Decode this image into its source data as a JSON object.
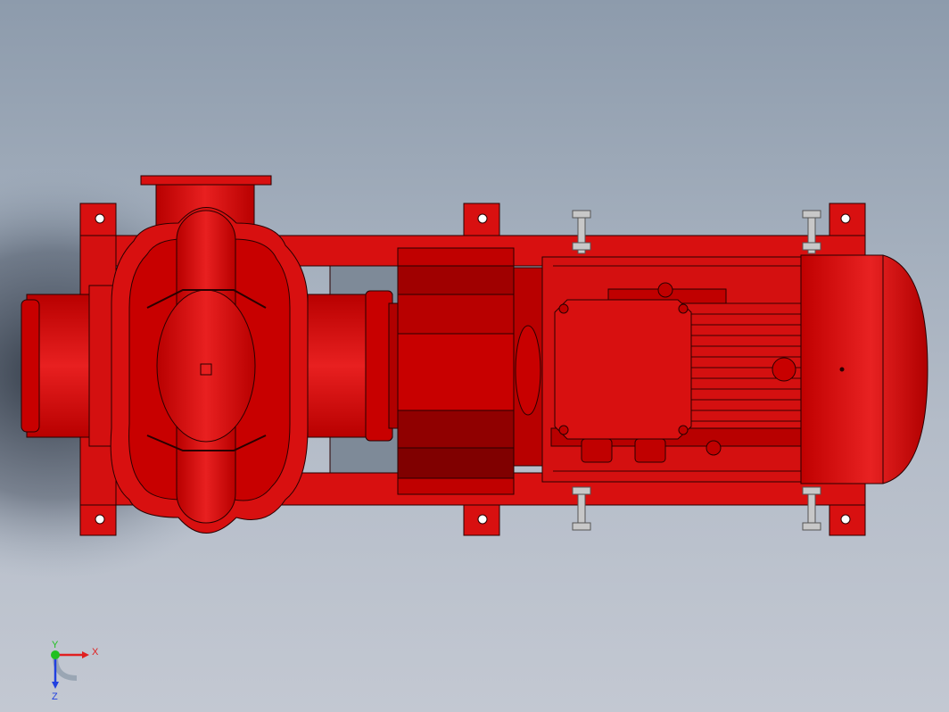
{
  "viewport": {
    "background_top": "#8d9bac",
    "background_bottom": "#c3c8d2"
  },
  "model": {
    "description_icon": "split-case-fire-pump-with-motor",
    "body_color": "#d81010",
    "body_dark": "#a80000",
    "body_shade": "#8a0000",
    "edge_color": "#2a0000",
    "hardware_color": "#c8c8c8"
  },
  "triad": {
    "x_label": "X",
    "y_label": "Y",
    "z_label": "Z",
    "x_color": "#e02020",
    "y_color": "#20c020",
    "z_color": "#2040e0"
  }
}
